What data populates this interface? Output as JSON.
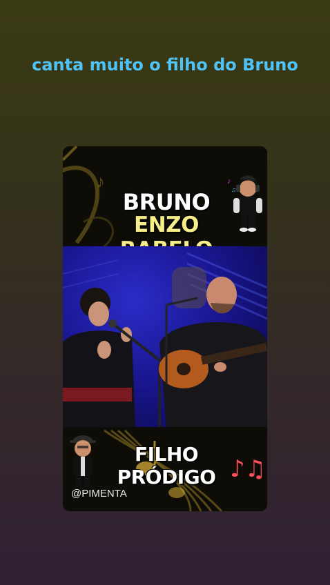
{
  "post": {
    "caption": "canta muito o filho do Bruno"
  },
  "card": {
    "top_title_line1": "BRUNO",
    "top_title_line2": "ENZO RABELO",
    "song_title": "FILHO PRÓDIGO",
    "watermark": "@PIMENTA",
    "music_notes_glyph": "♪♫"
  },
  "icons": [
    "headphones-avatar-sticker",
    "cap-avatar-sticker",
    "music-notes-icon"
  ],
  "colors": {
    "caption": "#4fc3f7",
    "highlight_title": "#f5ee8a",
    "stage_blue": "#1a1690"
  }
}
